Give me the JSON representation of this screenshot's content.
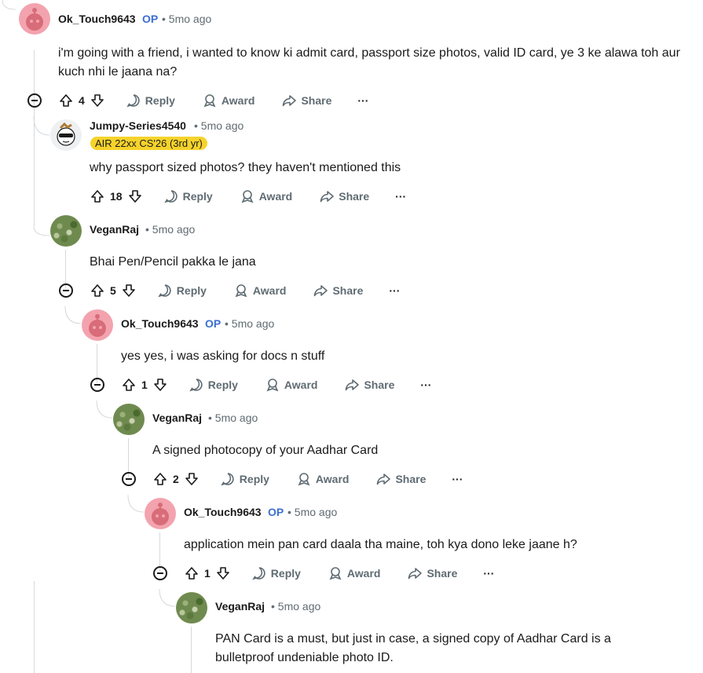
{
  "comments": [
    {
      "user": "Ok_Touch9643",
      "op": "OP",
      "time": "5mo ago",
      "text": "i'm going with a friend, i wanted to know ki admit card, passport size photos, valid ID card, ye 3 ke alawa toh aur kuch nhi le jaana na?",
      "votes": "4"
    },
    {
      "user": "Jumpy-Series4540",
      "flair": "AIR 22xx CS'26 (3rd yr)",
      "time": "5mo ago",
      "text": "why passport sized photos? they haven't mentioned this",
      "votes": "18"
    },
    {
      "user": "VeganRaj",
      "time": "5mo ago",
      "text": "Bhai Pen/Pencil pakka le jana",
      "votes": "5"
    },
    {
      "user": "Ok_Touch9643",
      "op": "OP",
      "time": "5mo ago",
      "text": "yes yes, i was asking for docs n stuff",
      "votes": "1"
    },
    {
      "user": "VeganRaj",
      "time": "5mo ago",
      "text": "A signed photocopy of your Aadhar Card",
      "votes": "2"
    },
    {
      "user": "Ok_Touch9643",
      "op": "OP",
      "time": "5mo ago",
      "text": "application mein pan card daala tha maine, toh kya dono leke jaane h?",
      "votes": "1"
    },
    {
      "user": "VeganRaj",
      "time": "5mo ago",
      "text": "PAN Card is a must, but just in case, a signed copy of Aadhar Card is a bulletproof undeniable photo ID."
    }
  ],
  "actions": {
    "reply": "Reply",
    "award": "Award",
    "share": "Share",
    "more": "···"
  },
  "dot": "•"
}
